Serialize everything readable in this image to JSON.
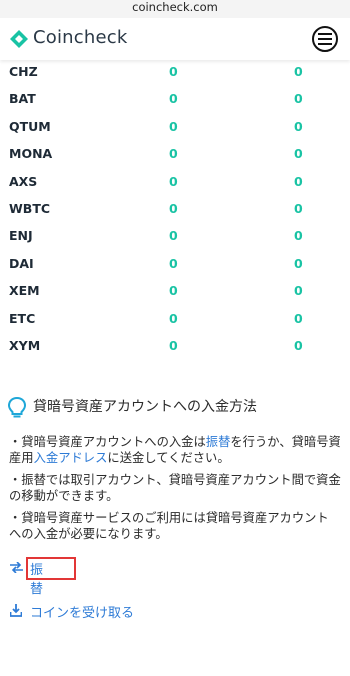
{
  "browser": {
    "url": "coincheck.com"
  },
  "header": {
    "brand": "Coincheck"
  },
  "colors": {
    "accent": "#19c3a4",
    "link": "#2e7bd6",
    "highlight": "#e23636"
  },
  "balances": [
    {
      "symbol": "CHZ",
      "value1": "0",
      "value2": "0"
    },
    {
      "symbol": "BAT",
      "value1": "0",
      "value2": "0"
    },
    {
      "symbol": "QTUM",
      "value1": "0",
      "value2": "0"
    },
    {
      "symbol": "MONA",
      "value1": "0",
      "value2": "0"
    },
    {
      "symbol": "AXS",
      "value1": "0",
      "value2": "0"
    },
    {
      "symbol": "WBTC",
      "value1": "0",
      "value2": "0"
    },
    {
      "symbol": "ENJ",
      "value1": "0",
      "value2": "0"
    },
    {
      "symbol": "DAI",
      "value1": "0",
      "value2": "0"
    },
    {
      "symbol": "XEM",
      "value1": "0",
      "value2": "0"
    },
    {
      "symbol": "ETC",
      "value1": "0",
      "value2": "0"
    },
    {
      "symbol": "XYM",
      "value1": "0",
      "value2": "0"
    }
  ],
  "info": {
    "title": "貸暗号資産アカウントへの入金方法",
    "note1_a": "・貸暗号資産アカウントへの入金は",
    "note1_link1": "振替",
    "note1_b": "を行うか、貸暗号資産用",
    "note1_link2": "入金アドレス",
    "note1_c": "に送金してください。",
    "note2": "・振替では取引アカウント、貸暗号資産アカウント間で資金の移動ができます。",
    "note3": "・貸暗号資産サービスのご利用には貸暗号資産アカウントへの入金が必要になります。"
  },
  "actions": {
    "transfer_label": "振替",
    "receive_label": "コインを受け取る"
  }
}
